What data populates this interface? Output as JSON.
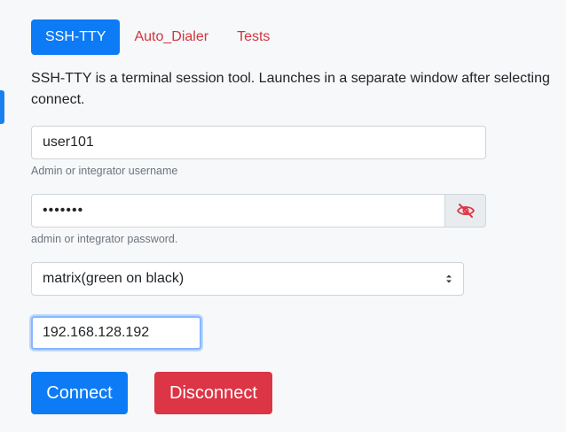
{
  "tabs": [
    {
      "label": "SSH-TTY",
      "active": true
    },
    {
      "label": "Auto_Dialer",
      "active": false
    },
    {
      "label": "Tests",
      "active": false
    }
  ],
  "intro": "SSH-TTY is a terminal session tool. Launches in a separate window after selecting connect.",
  "username": {
    "value": "user101",
    "help": "Admin or integrator username"
  },
  "password": {
    "value": "•••••••",
    "help": "admin or integrator password.",
    "toggle_icon": "eye-slash-icon"
  },
  "theme": {
    "selected": "matrix(green on black)"
  },
  "host": {
    "value": "192.168.128.192"
  },
  "buttons": {
    "connect": "Connect",
    "disconnect": "Disconnect"
  },
  "colors": {
    "primary": "#0d7bf5",
    "danger": "#dc3545",
    "tab_link": "#d0353e"
  }
}
